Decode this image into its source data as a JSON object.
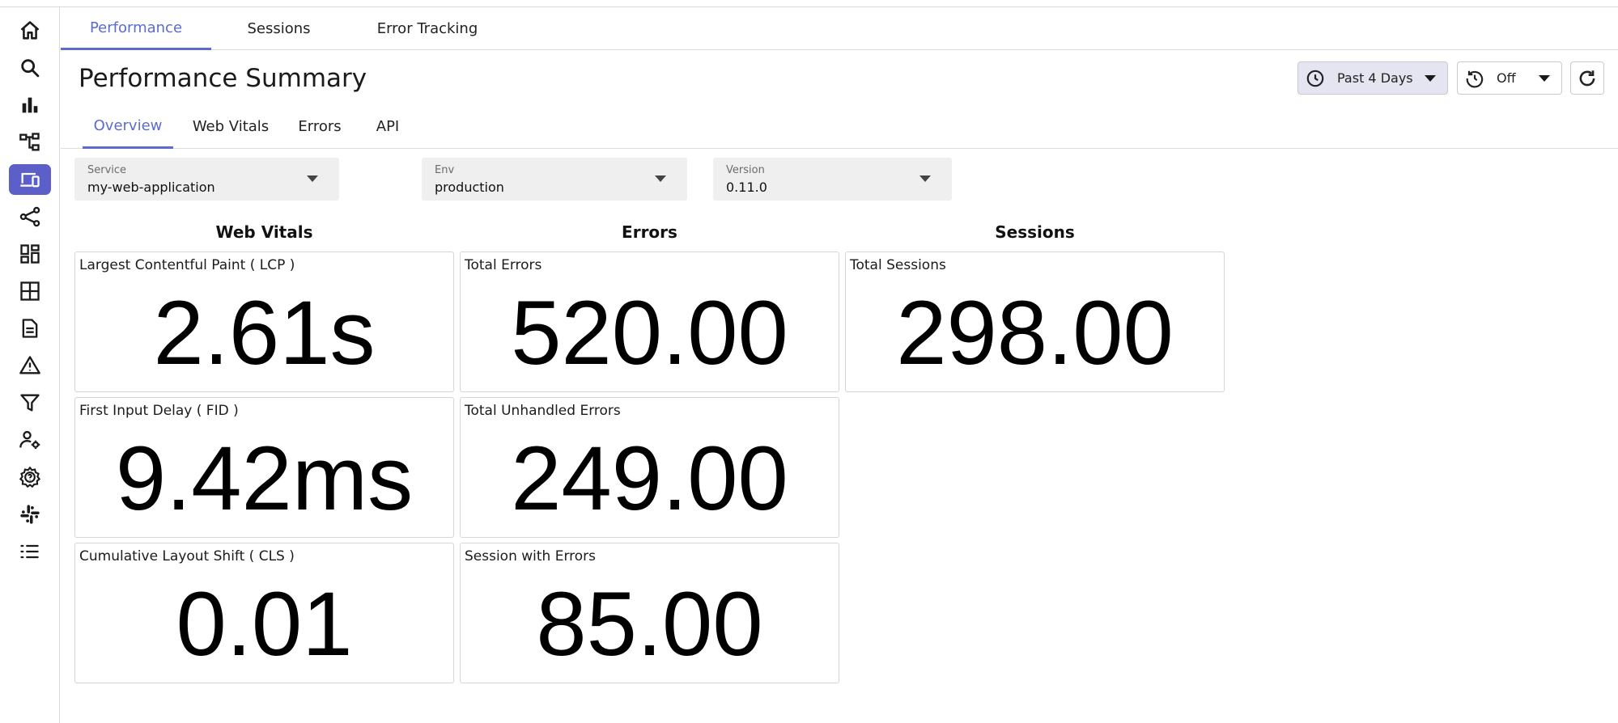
{
  "sidebar": {
    "items": [
      {
        "icon": "home-icon"
      },
      {
        "icon": "search-icon"
      },
      {
        "icon": "bar-chart-icon"
      },
      {
        "icon": "service-map-icon"
      },
      {
        "icon": "devices-icon",
        "active": true
      },
      {
        "icon": "share-nodes-icon"
      },
      {
        "icon": "dashboard-icon"
      },
      {
        "icon": "grid-icon"
      },
      {
        "icon": "document-icon"
      },
      {
        "icon": "alert-icon"
      },
      {
        "icon": "filter-icon"
      },
      {
        "icon": "user-settings-icon"
      },
      {
        "icon": "help-gear-icon"
      },
      {
        "icon": "slack-icon"
      },
      {
        "icon": "list-icon"
      }
    ],
    "active_color": "#5b5fc7"
  },
  "top_tabs": [
    "Performance",
    "Sessions",
    "Error Tracking"
  ],
  "page_title": "Performance Summary",
  "controls": {
    "time_range": "Past 4 Days",
    "auto_refresh": "Off"
  },
  "sub_tabs": [
    "Overview",
    "Web Vitals",
    "Errors",
    "API"
  ],
  "filters": {
    "service": {
      "label": "Service",
      "value": "my-web-application"
    },
    "env": {
      "label": "Env",
      "value": "production"
    },
    "version": {
      "label": "Version",
      "value": "0.11.0"
    }
  },
  "sections": {
    "web_vitals": {
      "heading": "Web Vitals",
      "cards": [
        {
          "title": "Largest Contentful Paint ( LCP )",
          "value": "2.61s"
        },
        {
          "title": "First Input Delay ( FID )",
          "value": "9.42ms"
        },
        {
          "title": "Cumulative Layout Shift ( CLS )",
          "value": "0.01"
        }
      ]
    },
    "errors": {
      "heading": "Errors",
      "cards": [
        {
          "title": "Total Errors",
          "value": "520.00"
        },
        {
          "title": "Total Unhandled Errors",
          "value": "249.00"
        },
        {
          "title": "Session with Errors",
          "value": "85.00"
        }
      ]
    },
    "sessions": {
      "heading": "Sessions",
      "cards": [
        {
          "title": "Total Sessions",
          "value": "298.00"
        }
      ]
    }
  },
  "colors": {
    "accent": "#5b6bd0",
    "time_control_bg": "#e5e5f2"
  }
}
